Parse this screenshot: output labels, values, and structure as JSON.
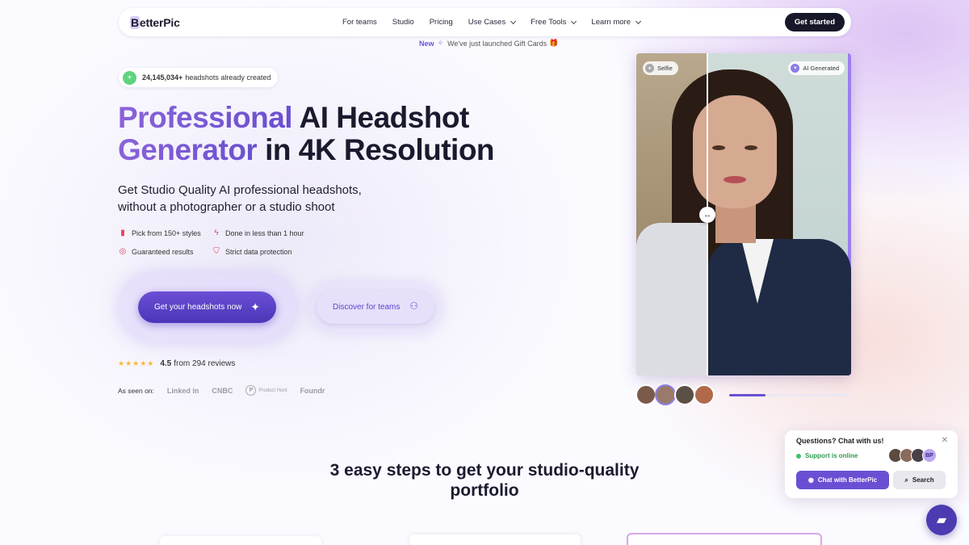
{
  "nav": {
    "logo": "BetterPic",
    "links": [
      "For teams",
      "Studio",
      "Pricing",
      "Use Cases",
      "Free Tools",
      "Learn more"
    ],
    "cta": "Get started"
  },
  "announcement": {
    "new": "New",
    "text": "We've just launched Gift Cards"
  },
  "badge": {
    "count": "24,145,034+",
    "text": "headshots already created"
  },
  "hero": {
    "title_line1_accent": "Professional",
    "title_line1_rest": " AI Headshot",
    "title_line2_accent": "Generator",
    "title_line2_rest": " in 4K Resolution",
    "subtitle": "Get Studio Quality AI professional headshots, without a photographer or a studio shoot"
  },
  "features": [
    "Pick from 150+ styles",
    "Done in less than 1 hour",
    "Guaranteed results",
    "Strict data protection"
  ],
  "cta_primary": "Get your headshots now",
  "cta_secondary": "Discover for teams",
  "rating": {
    "score": "4.5",
    "text": "from 294 reviews",
    "stars": 4.5
  },
  "seen_on": {
    "label": "As seen on:",
    "logos": [
      "Linked in",
      "CNBC",
      "Product Hunt",
      "Foundr"
    ]
  },
  "compare": {
    "left_tag": "Selfie",
    "right_tag": "AI Generated",
    "progress": 0.3
  },
  "steps": {
    "title": "3 easy steps to get your studio-quality portfolio"
  },
  "chat": {
    "title": "Questions? Chat with us!",
    "status": "Support is online",
    "avatar_initials": "BP",
    "chat_button": "Chat with BetterPic",
    "search_button": "Search"
  },
  "colors": {
    "accent": "#6a4fd4",
    "dark": "#17172a",
    "online": "#3cc36a",
    "star": "#f5b83d"
  }
}
